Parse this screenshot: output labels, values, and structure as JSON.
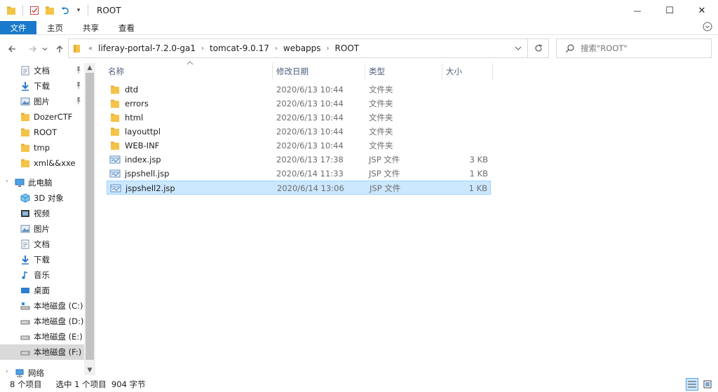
{
  "window": {
    "title": "ROOT",
    "quick_access_dropdown": "▾",
    "controls": {
      "minimize": "—",
      "maximize": "☐",
      "close": "✕"
    }
  },
  "ribbon": {
    "tabs": [
      "文件",
      "主页",
      "共享",
      "查看"
    ]
  },
  "nav": {
    "overflow": "«",
    "breadcrumbs": [
      "liferay-portal-7.2.0-ga1",
      "tomcat-9.0.17",
      "webapps",
      "ROOT"
    ],
    "separator": "›",
    "search_placeholder": "搜索\"ROOT\""
  },
  "sidebar": {
    "items": [
      {
        "label": "文档",
        "icon": "documents-icon",
        "pinned": true
      },
      {
        "label": "下载",
        "icon": "download-icon",
        "pinned": true
      },
      {
        "label": "图片",
        "icon": "pictures-icon",
        "pinned": true
      },
      {
        "label": "DozerCTF",
        "icon": "folder-icon",
        "pinned": false
      },
      {
        "label": "ROOT",
        "icon": "folder-icon",
        "pinned": false
      },
      {
        "label": "tmp",
        "icon": "folder-icon",
        "pinned": false
      },
      {
        "label": "xml&&xxe",
        "icon": "folder-icon",
        "pinned": false
      },
      {
        "label": "此电脑",
        "icon": "computer-icon",
        "pinned": false
      },
      {
        "label": "3D 对象",
        "icon": "3d-objects-icon",
        "pinned": false
      },
      {
        "label": "视频",
        "icon": "video-icon",
        "pinned": false
      },
      {
        "label": "图片",
        "icon": "pictures-icon",
        "pinned": false
      },
      {
        "label": "文档",
        "icon": "documents-icon",
        "pinned": false
      },
      {
        "label": "下载",
        "icon": "download-icon",
        "pinned": false
      },
      {
        "label": "音乐",
        "icon": "music-icon",
        "pinned": false
      },
      {
        "label": "桌面",
        "icon": "desktop-icon",
        "pinned": false
      },
      {
        "label": "本地磁盘 (C:)",
        "icon": "system-drive-icon",
        "pinned": false
      },
      {
        "label": "本地磁盘 (D:)",
        "icon": "drive-icon",
        "pinned": false
      },
      {
        "label": "本地磁盘 (E:)",
        "icon": "drive-icon",
        "pinned": false
      },
      {
        "label": "本地磁盘 (F:)",
        "icon": "drive-icon",
        "pinned": false,
        "selected": true
      },
      {
        "label": "网络",
        "icon": "network-icon",
        "pinned": false
      }
    ]
  },
  "columns": [
    "名称",
    "修改日期",
    "类型",
    "大小"
  ],
  "files": [
    {
      "name": "dtd",
      "date": "2020/6/13 10:44",
      "type": "文件夹",
      "size": "",
      "kind": "folder"
    },
    {
      "name": "errors",
      "date": "2020/6/13 10:44",
      "type": "文件夹",
      "size": "",
      "kind": "folder"
    },
    {
      "name": "html",
      "date": "2020/6/13 10:44",
      "type": "文件夹",
      "size": "",
      "kind": "folder"
    },
    {
      "name": "layouttpl",
      "date": "2020/6/13 10:44",
      "type": "文件夹",
      "size": "",
      "kind": "folder"
    },
    {
      "name": "WEB-INF",
      "date": "2020/6/13 10:44",
      "type": "文件夹",
      "size": "",
      "kind": "folder"
    },
    {
      "name": "index.jsp",
      "date": "2020/6/13 17:38",
      "type": "JSP 文件",
      "size": "3 KB",
      "kind": "file"
    },
    {
      "name": "jspshell.jsp",
      "date": "2020/6/14 11:33",
      "type": "JSP 文件",
      "size": "1 KB",
      "kind": "file"
    },
    {
      "name": "jspshell2.jsp",
      "date": "2020/6/14 13:06",
      "type": "JSP 文件",
      "size": "1 KB",
      "kind": "file",
      "selected": true
    }
  ],
  "status": {
    "count": "8 个项目",
    "selection": "选中 1 个项目  904 字节"
  },
  "colors": {
    "accent": "#1979ca",
    "selection_bg": "#cce8ff",
    "selection_border": "#99d1ff",
    "folder": "#f4c348"
  }
}
